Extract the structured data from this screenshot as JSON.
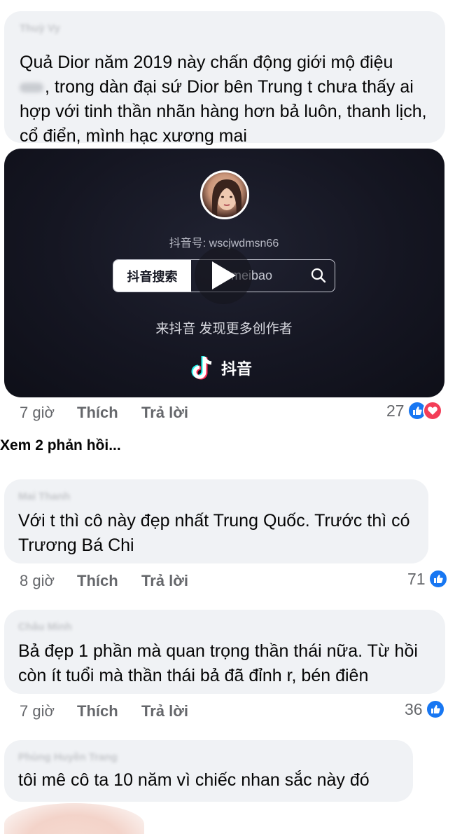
{
  "comments": [
    {
      "author": "Thuỳ Vy",
      "text_line1": "Quả Dior năm 2019 này chấn động giới mộ điệu",
      "text_rest": ", trong dàn đại sứ Dior bên Trung t chưa thấy ai hợp với tinh thần nhãn hàng hơn bả luôn, thanh lịch, cổ điển, mình hạc xương mai",
      "time": "7 giờ",
      "like_label": "Thích",
      "reply_label": "Trả lời",
      "reactions": "27",
      "reaction_icons": [
        "like-icon",
        "love-icon"
      ]
    },
    {
      "author": "Mai Thanh",
      "text": "Với t thì cô này đẹp nhất Trung Quốc. Trước thì có Trương Bá Chi",
      "time": "8 giờ",
      "like_label": "Thích",
      "reply_label": "Trả lời",
      "reactions": "71",
      "reaction_icons": [
        "like-icon"
      ]
    },
    {
      "author": "Châu Minh",
      "text": "Bả đẹp 1 phần mà quan trọng thần thái nữa. Từ hồi còn ít tuổi mà thần thái bả đã đỉnh r, bén điên",
      "time": "7 giờ",
      "like_label": "Thích",
      "reply_label": "Trả lời",
      "reactions": "36",
      "reaction_icons": [
        "like-icon"
      ]
    },
    {
      "author": "Phùng Huyền Trang",
      "text": "tôi mê cô ta 10 năm vì chiếc nhan sắc này đó"
    }
  ],
  "view_more": "Xem 2 phản hồi...",
  "tiktok_card": {
    "douyin_id": "抖音号: wscjwdmsn66",
    "search_button": "抖音搜索",
    "search_term": "meibao",
    "discover_text": "来抖音 发现更多创作者",
    "brand_name": "抖音"
  },
  "colors": {
    "bubble": "#f0f2f5",
    "meta_text": "#65676b",
    "like_blue": "#1877f2",
    "love_red": "#f33e58",
    "card_bg": "#151622"
  }
}
